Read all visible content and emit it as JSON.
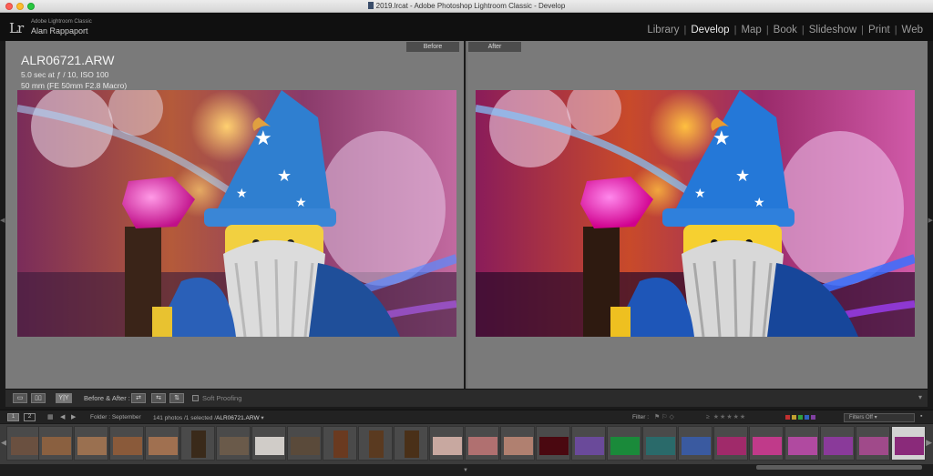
{
  "window": {
    "title": "2019.lrcat - Adobe Photoshop Lightroom Classic - Develop"
  },
  "identity": {
    "logo": "Lr",
    "app_name": "Adobe Lightroom Classic",
    "user_name": "Alan Rappaport"
  },
  "modules": [
    {
      "label": "Library",
      "active": false
    },
    {
      "label": "Develop",
      "active": true
    },
    {
      "label": "Map",
      "active": false
    },
    {
      "label": "Book",
      "active": false
    },
    {
      "label": "Slideshow",
      "active": false
    },
    {
      "label": "Print",
      "active": false
    },
    {
      "label": "Web",
      "active": false
    }
  ],
  "view": {
    "before_label": "Before",
    "after_label": "After",
    "info": {
      "filename": "ALR06721.ARW",
      "exposure": "5.0 sec at ƒ / 10, ISO 100",
      "lens": "50 mm (FE 50mm F2.8 Macro)"
    }
  },
  "toolbar": {
    "view_yy": "Y|Y",
    "before_after_label": "Before & After :",
    "soft_proofing_label": "Soft Proofing"
  },
  "filmbar": {
    "monitor_1": "1",
    "monitor_2": "2",
    "folder_label": "Folder : September",
    "photo_count": "141 photos /1 selected /",
    "selected_file": "ALR06721.ARW",
    "filter_label": "Filter :",
    "filters_value": "Filters Off"
  },
  "colors": {
    "accent_active": "#eaeaea",
    "module_inactive": "#9b9b9b",
    "panel_bg": "#7a7a7a",
    "chrome_bg": "#101010"
  }
}
